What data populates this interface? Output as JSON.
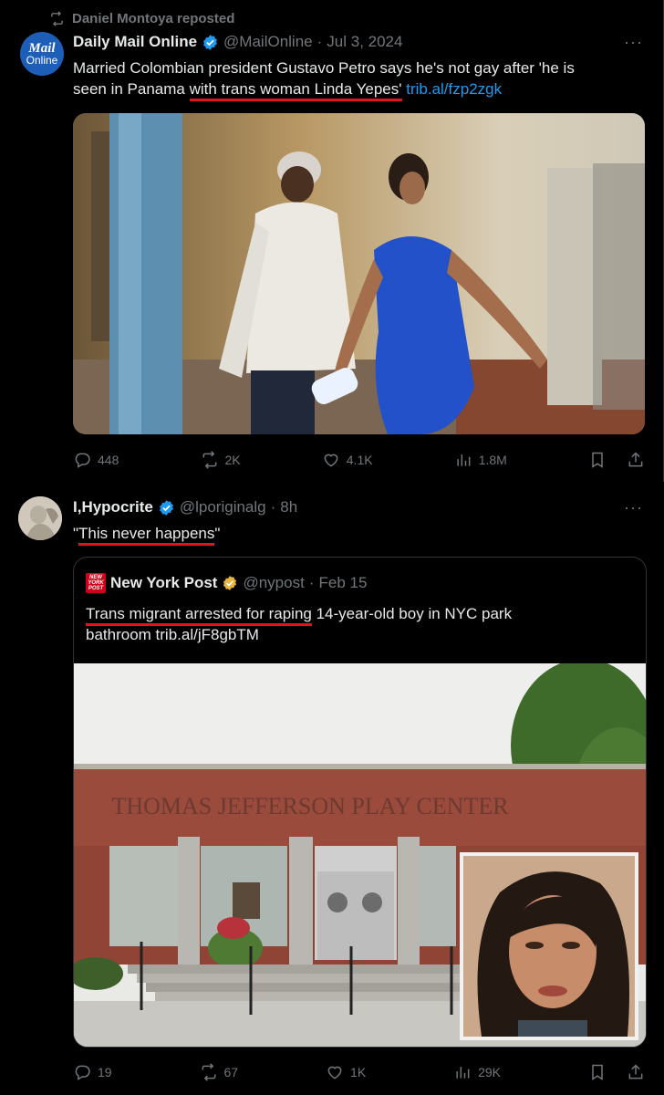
{
  "repost": {
    "label": "Daniel Montoya reposted"
  },
  "tweet1": {
    "author": {
      "name": "Daily Mail Online",
      "handle": "@MailOnline",
      "date": "Jul 3, 2024",
      "avatar_line1": "Mail",
      "avatar_line2": "Online"
    },
    "text_line1": "Married Colombian president Gustavo Petro says he's not gay after 'he is",
    "text_line2_prefix": "seen in Panama ",
    "text_line2_underlined": "with trans woman Linda Yepes'",
    "link": "trib.al/fzp2zgk",
    "stats": {
      "replies": "448",
      "reposts": "2K",
      "likes": "4.1K",
      "views": "1.8M"
    }
  },
  "tweet2": {
    "author": {
      "name": "I,Hypocrite",
      "handle": "@lporiginalg",
      "date": "8h"
    },
    "text_open": "\"",
    "text_underlined": "This never happens",
    "text_close": "\"",
    "quote": {
      "author": {
        "name": "New York Post",
        "handle": "@nypost",
        "date": "Feb 15",
        "logo_lines": [
          "NEW",
          "YORK",
          "POST"
        ]
      },
      "text_underlined": "Trans migrant arrested for raping",
      "text_rest": " 14-year-old boy in NYC park",
      "text_line2": "bathroom trib.al/jF8gbTM",
      "building_sign": "THOMAS JEFFERSON PLAY CENTER"
    },
    "stats": {
      "replies": "19",
      "reposts": "67",
      "likes": "1K",
      "views": "29K"
    }
  },
  "icons": [
    "repost-icon",
    "verified-badge-icon",
    "more-icon",
    "reply-icon",
    "like-icon",
    "views-icon",
    "bookmark-icon",
    "share-icon",
    "gold-verified-badge-icon"
  ],
  "colors": {
    "background": "#000000",
    "text": "#e7e9ea",
    "muted": "#71767b",
    "link": "#1d9bf0",
    "verified_blue": "#1d9bf0",
    "verified_gold": "#e8b53c",
    "underline_red": "#e0141b"
  }
}
